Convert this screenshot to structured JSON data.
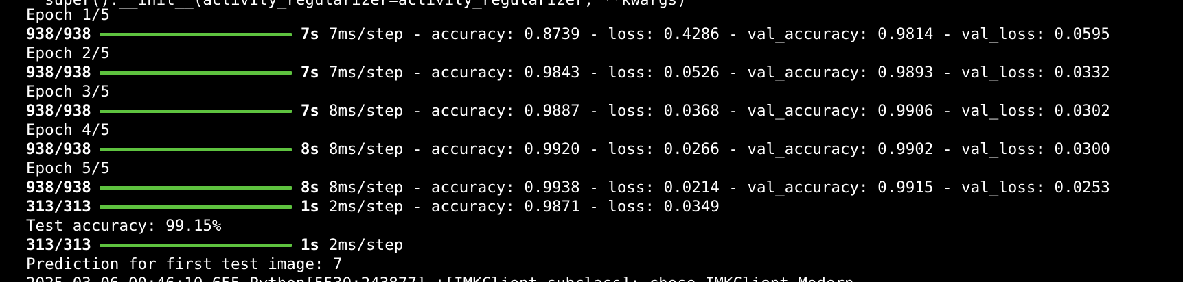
{
  "window": {
    "background": "#000000",
    "foreground": "#ffffff",
    "progress_color": "#5ec23f"
  },
  "terminal": {
    "top_partial": "  super().__init__(activity_regularizer=activity_regularizer, **kwargs)",
    "epochs": [
      {
        "header": "Epoch 1/5",
        "steps": "938/938",
        "progress": 1.0,
        "time": "7s",
        "metrics": "7ms/step - accuracy: 0.8739 - loss: 0.4286 - val_accuracy: 0.9814 - val_loss: 0.0595"
      },
      {
        "header": "Epoch 2/5",
        "steps": "938/938",
        "progress": 1.0,
        "time": "7s",
        "metrics": "7ms/step - accuracy: 0.9843 - loss: 0.0526 - val_accuracy: 0.9893 - val_loss: 0.0332"
      },
      {
        "header": "Epoch 3/5",
        "steps": "938/938",
        "progress": 1.0,
        "time": "7s",
        "metrics": "8ms/step - accuracy: 0.9887 - loss: 0.0368 - val_accuracy: 0.9906 - val_loss: 0.0302"
      },
      {
        "header": "Epoch 4/5",
        "steps": "938/938",
        "progress": 1.0,
        "time": "8s",
        "metrics": "8ms/step - accuracy: 0.9920 - loss: 0.0266 - val_accuracy: 0.9902 - val_loss: 0.0300"
      },
      {
        "header": "Epoch 5/5",
        "steps": "938/938",
        "progress": 1.0,
        "time": "8s",
        "metrics": "8ms/step - accuracy: 0.9938 - loss: 0.0214 - val_accuracy: 0.9915 - val_loss: 0.0253"
      }
    ],
    "evaluate": {
      "steps": "313/313",
      "progress": 1.0,
      "time": "1s",
      "metrics": "2ms/step - accuracy: 0.9871 - loss: 0.0349"
    },
    "test_accuracy_line": "Test accuracy: 99.15%",
    "predict": {
      "steps": "313/313",
      "progress": 1.0,
      "time": "1s",
      "metrics": "2ms/step"
    },
    "prediction_line": "Prediction for first test image: 7",
    "bottom_partial": "2025-03-06 00:46:10.655 Python[5530:243877] +[IMKClient subclass]: chose IMKClient_Modern"
  }
}
